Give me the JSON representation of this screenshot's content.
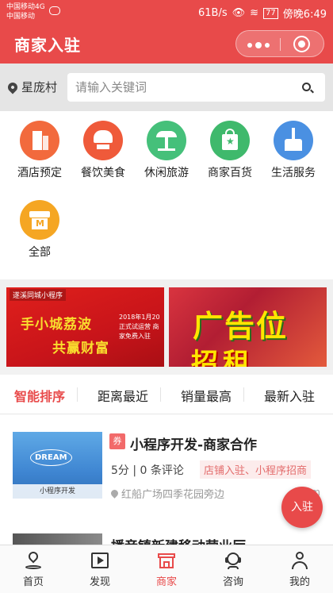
{
  "status_bar": {
    "carrier1": "中国移动4G",
    "carrier2": "中国移动",
    "speed": "61B/s",
    "battery": "77",
    "time": "傍晚6:49"
  },
  "nav": {
    "title": "商家入驻"
  },
  "search": {
    "location": "星庞村",
    "placeholder": "请输入关键词"
  },
  "categories": [
    {
      "label": "酒店预定",
      "icon": "hotel-icon",
      "color": "#f26a3d"
    },
    {
      "label": "餐饮美食",
      "icon": "chef-hat-icon",
      "color": "#ef5a3a"
    },
    {
      "label": "休闲旅游",
      "icon": "palm-tree-icon",
      "color": "#45c07a"
    },
    {
      "label": "商家百货",
      "icon": "shopping-bag-icon",
      "color": "#3fb96c"
    },
    {
      "label": "生活服务",
      "icon": "broom-icon",
      "color": "#4a90e2"
    },
    {
      "label": "全部",
      "icon": "shop-icon",
      "color": "#f5a623"
    }
  ],
  "banners": {
    "b1": {
      "tag": "遂溪同城小程序",
      "line1": "手小城荔波",
      "line2": "共赢财富",
      "date": "2018年1月20",
      "note": "正式试运营 商家免费入驻"
    },
    "b2": {
      "line1": "广告位",
      "line2": "招租"
    }
  },
  "sort_tabs": [
    "智能排序",
    "距离最近",
    "销量最高",
    "最新入驻"
  ],
  "listing": {
    "badge": "券",
    "title": "小程序开发-商家合作",
    "meta": "5分 | 0 条评论",
    "tags": "店铺入驻、小程序招商",
    "address": "红船广场四季花园旁边",
    "distance": "1km",
    "thumb_word": "DREAM",
    "thumb_caption": "小程序开发"
  },
  "listing2": {
    "title": "播音镇新建移动营业厅"
  },
  "fab": {
    "label": "入驻"
  },
  "tabbar": [
    {
      "label": "首页",
      "icon": "home-location-icon"
    },
    {
      "label": "发现",
      "icon": "video-icon"
    },
    {
      "label": "商家",
      "icon": "store-icon"
    },
    {
      "label": "咨询",
      "icon": "customer-service-icon"
    },
    {
      "label": "我的",
      "icon": "user-icon"
    }
  ],
  "colors": {
    "brand": "#e84a4a",
    "text": "#222222"
  }
}
